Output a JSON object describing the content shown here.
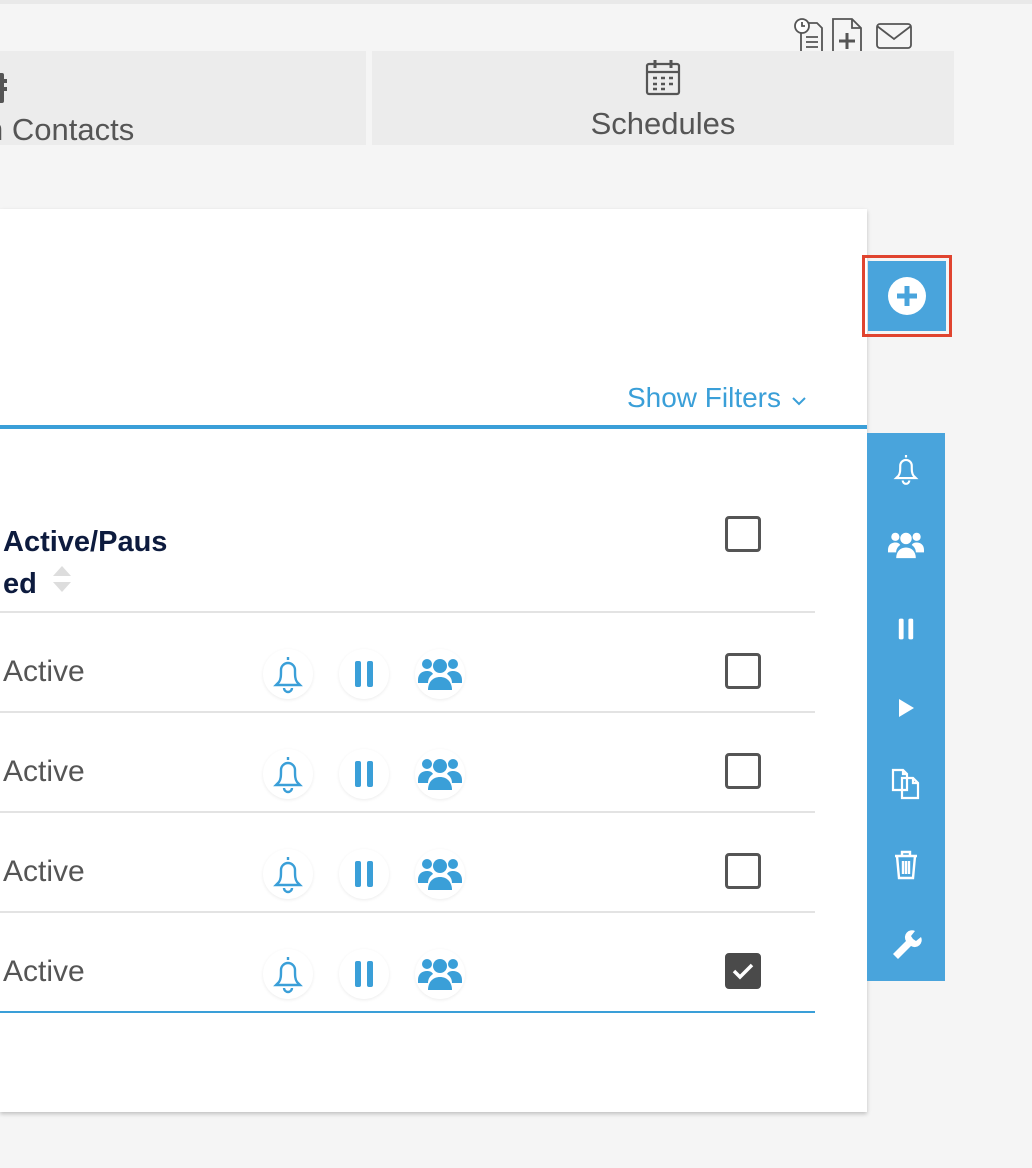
{
  "toolbar": {
    "icons": [
      "history-document-icon",
      "new-document-icon",
      "mail-icon"
    ]
  },
  "tabs": [
    {
      "label": "n Contacts",
      "icon": "address-book-icon"
    },
    {
      "label": "Schedules",
      "icon": "calendar-icon"
    }
  ],
  "filters": {
    "label": "Show Filters",
    "icon": "chevron-down-icon"
  },
  "table": {
    "column_header": "Active/Paus ed",
    "column_header_line1": "Active/Paus",
    "column_header_line2": "ed",
    "rows": [
      {
        "status": "Active",
        "checked": false
      },
      {
        "status": "Active",
        "checked": false
      },
      {
        "status": "Active",
        "checked": false
      },
      {
        "status": "Active",
        "checked": true
      }
    ],
    "row_actions": [
      "bell-icon",
      "pause-icon",
      "group-icon"
    ]
  },
  "add_button": {
    "icon": "plus-circle-icon",
    "highlight_color": "#e0442f"
  },
  "sidebar": {
    "items": [
      "bell-icon",
      "group-icon",
      "pause-icon",
      "play-icon",
      "copy-icon",
      "trash-icon",
      "wrench-icon"
    ]
  },
  "colors": {
    "accent": "#49a4dc",
    "link": "#3a9fd8",
    "header_text": "#0d1b3e"
  }
}
